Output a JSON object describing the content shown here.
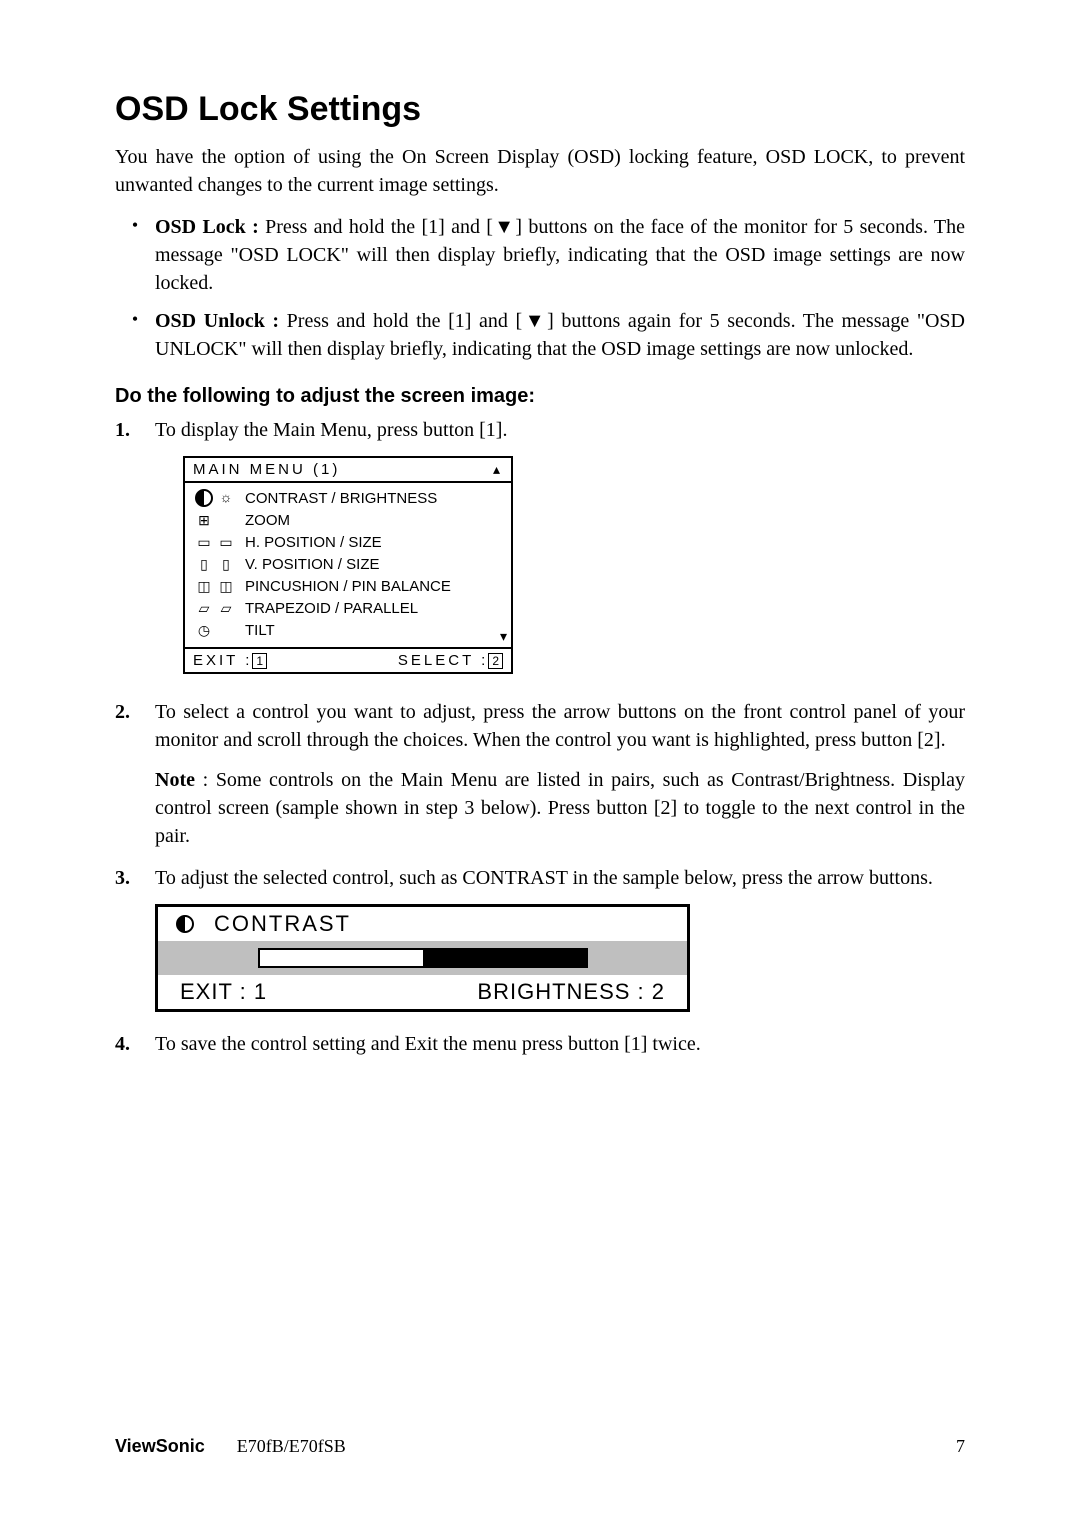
{
  "title": "OSD Lock Settings",
  "intro": "You have the option of using the On Screen Display (OSD) locking feature, OSD LOCK, to prevent unwanted changes to the current image settings.",
  "bullets": [
    {
      "label": "OSD Lock :",
      "text": " Press and hold the [1] and [▼] buttons on the face of the monitor for 5 seconds. The message \"OSD LOCK\" will then display briefly, indicating that the OSD image settings are now locked."
    },
    {
      "label": "OSD Unlock :",
      "text": " Press and hold the [1] and [▼] buttons again for 5 seconds. The message \"OSD UNLOCK\" will then display briefly, indicating that the OSD image settings are now unlocked."
    }
  ],
  "adjust_heading": "Do the following to adjust the screen image:",
  "steps": {
    "s1": "To display the Main Menu, press button [1].",
    "s2": "To select a control you want to adjust, press the arrow buttons on the front control panel of your monitor and scroll through the choices. When the control you want is highlighted, press button [2].",
    "note_bold": "Note",
    "note_text": " : Some controls on the Main Menu are listed in pairs, such as Contrast/Brightness. Display control screen (sample shown in step 3 below). Press button [2] to toggle to the next control in the pair.",
    "s3": "To adjust the selected control, such as CONTRAST in the sample below, press the arrow buttons.",
    "s4": "To save the control setting and Exit the menu press button [1] twice."
  },
  "nums": {
    "n1": "1.",
    "n2": "2.",
    "n3": "3.",
    "n4": "4."
  },
  "osd": {
    "title": "MAIN MENU (1)",
    "items": [
      "CONTRAST / BRIGHTNESS",
      "ZOOM",
      "H. POSITION / SIZE",
      "V. POSITION / SIZE",
      "PINCUSHION / PIN BALANCE",
      "TRAPEZOID / PARALLEL",
      "TILT"
    ],
    "exit": "EXIT :",
    "exit_key": "1",
    "select": "SELECT :",
    "select_key": "2"
  },
  "contrast": {
    "title": "CONTRAST",
    "exit": "EXIT : 1",
    "right": "BRIGHTNESS : 2"
  },
  "footer": {
    "brand": "ViewSonic",
    "model": "E70fB/E70fSB",
    "page": "7"
  }
}
